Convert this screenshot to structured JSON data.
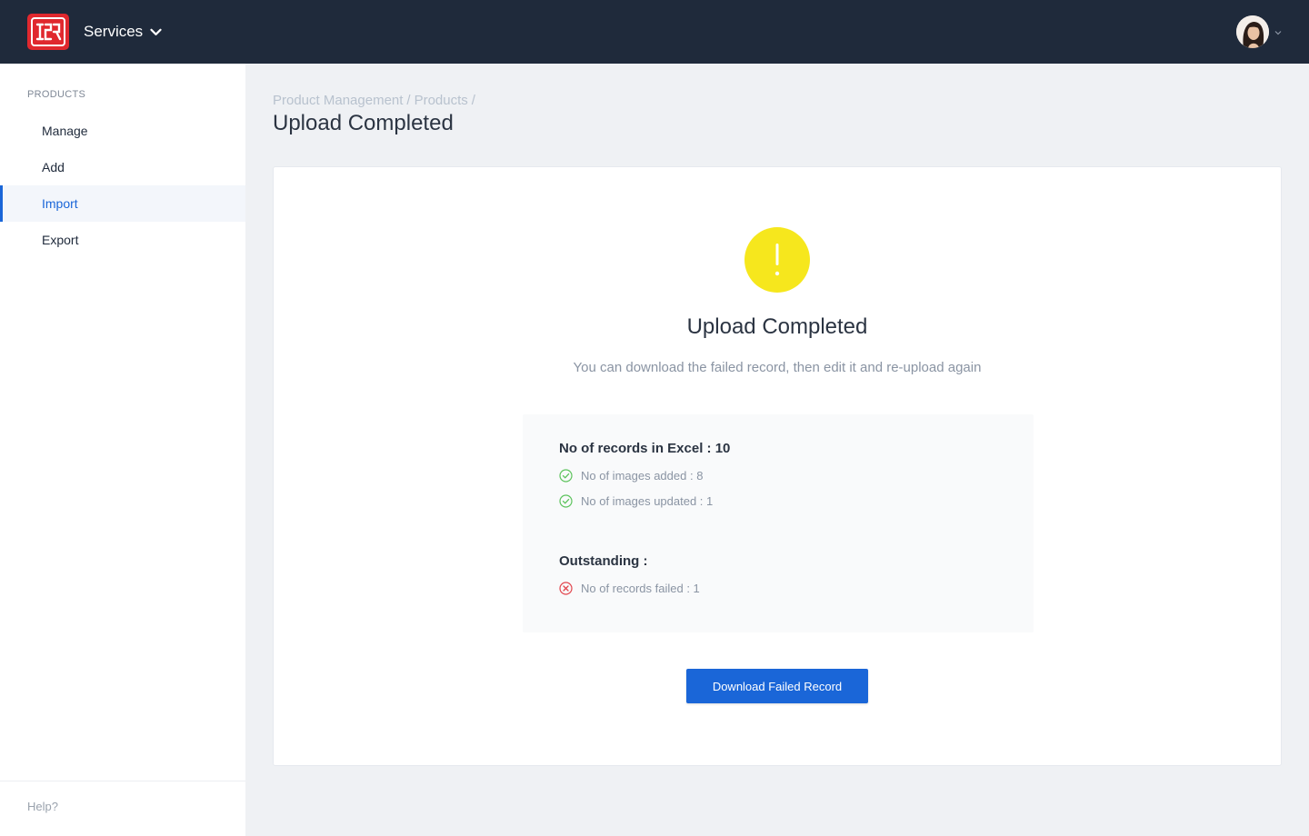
{
  "header": {
    "services_label": "Services",
    "colors": {
      "bar": "#1f2a3b",
      "logo": "#e0282e"
    }
  },
  "sidebar": {
    "section_title": "PRODUCTS",
    "items": [
      {
        "label": "Manage",
        "active": false
      },
      {
        "label": "Add",
        "active": false
      },
      {
        "label": "Import",
        "active": true
      },
      {
        "label": "Export",
        "active": false
      }
    ],
    "help_label": "Help?"
  },
  "breadcrumb": {
    "items": [
      "Product Management",
      "Products"
    ],
    "separator": "/"
  },
  "page_title": "Upload Completed",
  "card": {
    "icon": "warning-icon",
    "title": "Upload Completed",
    "subtitle": "You can download the failed record, then edit it and re-upload again",
    "summary": {
      "records_heading": "No of records in Excel : 10",
      "stats": [
        {
          "icon": "check-circle-icon",
          "label": "No of images added : 8"
        },
        {
          "icon": "check-circle-icon",
          "label": "No of images updated : 1"
        }
      ],
      "outstanding_heading": "Outstanding :",
      "failed": {
        "icon": "x-circle-icon",
        "label": "No of records failed : 1"
      }
    },
    "download_button_label": "Download Failed Record"
  },
  "colors": {
    "accent": "#1a66d8",
    "success": "#5cc35c",
    "error": "#e2454d",
    "warning": "#f6e71d"
  }
}
